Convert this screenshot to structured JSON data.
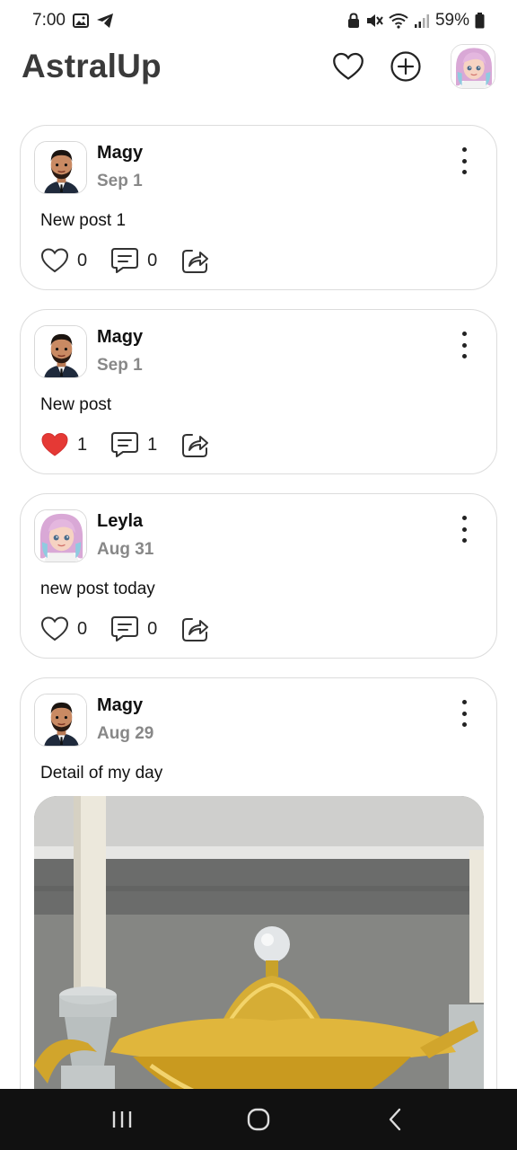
{
  "status_bar": {
    "time": "7:00",
    "battery": "59%",
    "icons": [
      "gallery-icon",
      "telegram-icon",
      "lock-icon",
      "mute-icon",
      "wifi-icon",
      "signal-icon",
      "battery-icon"
    ]
  },
  "header": {
    "title": "AstralUp",
    "icons": [
      "heart-icon",
      "plus-circle-icon",
      "profile-avatar"
    ]
  },
  "posts": [
    {
      "author": "Magy",
      "date": "Sep 1",
      "text": "New post 1",
      "likes": "0",
      "comments": "0",
      "liked": false,
      "avatar": "male-avatar"
    },
    {
      "author": "Magy",
      "date": "Sep 1",
      "text": "New post",
      "likes": "1",
      "comments": "1",
      "liked": true,
      "avatar": "male-avatar"
    },
    {
      "author": "Leyla",
      "date": "Aug 31",
      "text": "new post today",
      "likes": "0",
      "comments": "0",
      "liked": false,
      "avatar": "female-avatar"
    },
    {
      "author": "Magy",
      "date": "Aug 29",
      "text": "Detail of my day",
      "avatar": "male-avatar",
      "image": "golden-teapot-with-candles"
    }
  ],
  "colors": {
    "liked_heart": "#e53935",
    "date_text": "#888888",
    "card_border": "#dcdcdc",
    "nav_bar": "#111111"
  },
  "nav": [
    "recents-icon",
    "home-icon",
    "back-icon"
  ]
}
